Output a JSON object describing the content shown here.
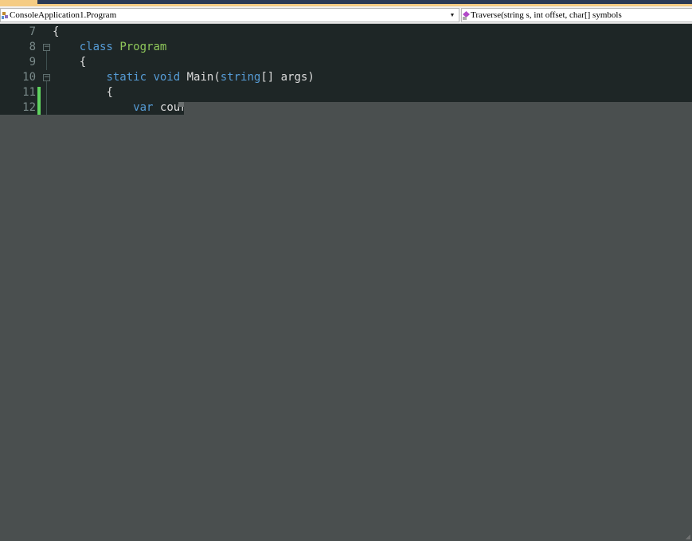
{
  "navbar": {
    "type_combo": "ConsoleApplication1.Program",
    "member_combo": "Traverse(string s, int offset, char[] symbols"
  },
  "editor": {
    "lines": [
      {
        "num": "7",
        "text": "{"
      },
      {
        "num": "8",
        "kw": "class",
        "cls": "Program"
      },
      {
        "num": "9",
        "text": "{"
      },
      {
        "num": "10",
        "kw1": "static",
        "kw2": "void",
        "name": "Main(",
        "kw3": "string",
        "rest": "[] args)"
      },
      {
        "num": "11",
        "text": "{"
      },
      {
        "num": "12",
        "kw": "var",
        "rest": "cour"
      }
    ]
  },
  "colors": {
    "background": "#1e2626",
    "keyword": "#569cd6",
    "type": "#8fc75a",
    "overlay": "#4a4f4f",
    "change_bar": "#5fd35f"
  }
}
